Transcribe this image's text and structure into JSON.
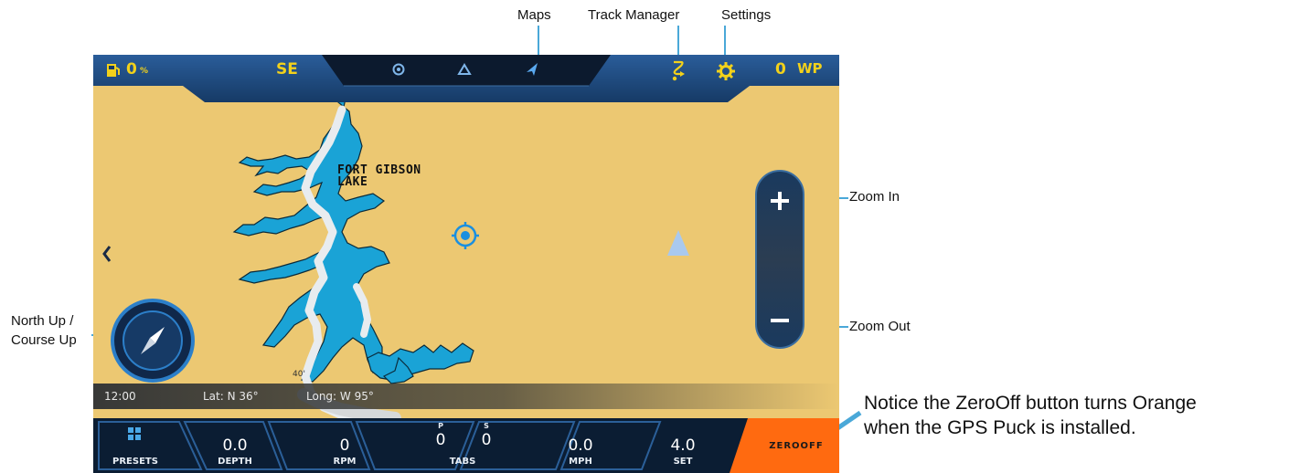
{
  "annotations": {
    "maps": "Maps",
    "track_manager": "Track Manager",
    "settings": "Settings",
    "zoom_in": "Zoom In",
    "zoom_out": "Zoom Out",
    "north_up": "North Up /",
    "course_up": "Course Up",
    "notice_line1": "Notice the ZeroOff button turns Orange",
    "notice_line2": "when the GPS Puck is installed."
  },
  "topbar": {
    "fuel_value": "0",
    "fuel_unit": "%",
    "heading": "SE",
    "waypoints_value": "0",
    "waypoints_unit": "WP"
  },
  "map": {
    "lake_label_line1": "FORT GIBSON",
    "lake_label_line2": "LAKE",
    "depth_marker": "40"
  },
  "status": {
    "time": "12:00",
    "lat": "Lat: N 36°",
    "long": "Long: W 95°"
  },
  "bottombar": {
    "presets_label": "PRESETS",
    "depth_value": "0.0",
    "depth_label": "DEPTH",
    "rpm_value": "0",
    "rpm_label": "RPM",
    "tabs_p_label": "P",
    "tabs_s_label": "S",
    "tabs_p_value": "0",
    "tabs_s_value": "0",
    "tabs_label": "TABS",
    "mph_value": "0.0",
    "mph_label": "MPH",
    "set_value": "4.0",
    "set_label": "SET",
    "zerooff_label": "ZEROOFF"
  },
  "colors": {
    "map_land": "#ecc872",
    "water": "#1aa3d6",
    "accent_yellow": "#f2d11b",
    "nav_blue": "#1b4f8a",
    "zerooff_orange": "#ff6a10"
  },
  "icons": [
    "fuel-icon",
    "sonar-icon",
    "autopilot-icon",
    "maps-nav-icon",
    "track-manager-icon",
    "settings-gear-icon",
    "back-chevron-icon",
    "gps-target-icon",
    "boat-position-icon",
    "compass-icon",
    "presets-grid-icon"
  ]
}
